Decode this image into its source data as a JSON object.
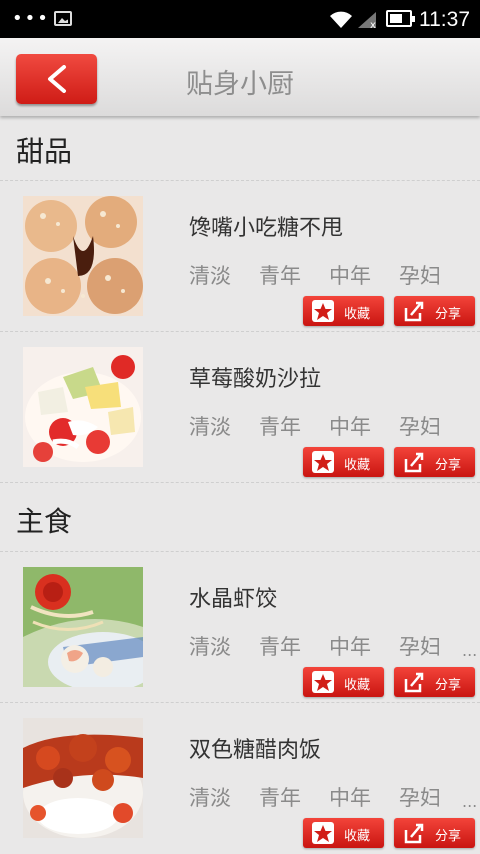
{
  "status_bar": {
    "time": "11:37",
    "dots": "•••"
  },
  "header": {
    "title": "贴身小厨",
    "back_icon": "chevron-left-icon"
  },
  "sections": [
    {
      "title": "甜品",
      "items": [
        {
          "name": "馋嘴小吃糖不甩",
          "tags": [
            "清淡",
            "青年",
            "中年",
            "孕妇"
          ],
          "more": "",
          "fav_label": "收藏",
          "share_label": "分享"
        },
        {
          "name": "草莓酸奶沙拉",
          "tags": [
            "清淡",
            "青年",
            "中年",
            "孕妇"
          ],
          "more": "",
          "fav_label": "收藏",
          "share_label": "分享"
        }
      ]
    },
    {
      "title": "主食",
      "items": [
        {
          "name": "水晶虾饺",
          "tags": [
            "清淡",
            "青年",
            "中年",
            "孕妇"
          ],
          "more": "...",
          "fav_label": "收藏",
          "share_label": "分享"
        },
        {
          "name": "双色糖醋肉饭",
          "tags": [
            "清淡",
            "青年",
            "中年",
            "孕妇"
          ],
          "more": "...",
          "fav_label": "收藏",
          "share_label": "分享"
        }
      ]
    }
  ],
  "colors": {
    "accent": "#e2271f",
    "background": "#e9e8e8",
    "title_gray": "#8e8e8e",
    "tag_gray": "#8a8a8a"
  },
  "icons": {
    "fav": "star-icon",
    "share": "share-edit-icon"
  }
}
